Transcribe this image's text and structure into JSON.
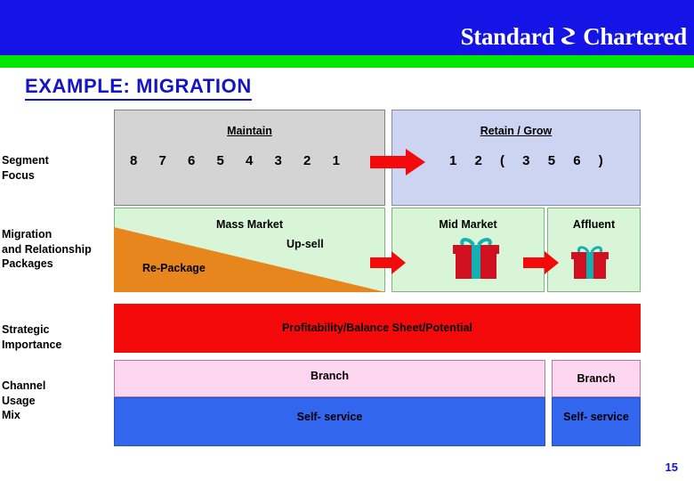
{
  "header": {
    "brand_part1": "Standard",
    "brand_part2": "Chartered",
    "brand_mark_icon": "standard-chartered-logo-icon"
  },
  "title": "EXAMPLE: MIGRATION",
  "row_labels": {
    "segment_focus": "Segment\nFocus",
    "segment_focus_line1": "Segment",
    "segment_focus_line2": "Focus",
    "migration_line1": "Migration",
    "migration_line2": "and Relationship",
    "migration_line3": "Packages",
    "strategic_line1": "Strategic",
    "strategic_line2": "Importance",
    "channel_line1": "Channel",
    "channel_line2": "Usage",
    "channel_line3": "Mix"
  },
  "segment_row": {
    "maintain_header": "Maintain",
    "retain_header": "Retain / Grow",
    "numbers_left": "8 7 6 5 4 3 2 1",
    "numbers_right": "1 2 ( 3 5 6 )"
  },
  "migration_row": {
    "mass_market": "Mass Market",
    "mid_market": "Mid Market",
    "affluent": "Affluent",
    "repackage": "Re-Package",
    "upsell": "Up-sell"
  },
  "strategic_row": {
    "text": "Profitability/Balance Sheet/Potential"
  },
  "channel_row": {
    "branch_left": "Branch",
    "self_service_left": "Self- service",
    "branch_right": "Branch",
    "self_service_right": "Self- service"
  },
  "page_number": "15",
  "colors": {
    "header_blue": "#1414e6",
    "green_band": "#00e800",
    "title_blue": "#1414c8",
    "maintain_gray": "#d4d4d4",
    "retain_lavender": "#ccd4f2",
    "segment_green": "#d8f5d8",
    "repackage_orange": "#e8861e",
    "strategic_red": "#f40a0a",
    "branch_pink": "#ffd6ef",
    "self_service_blue": "#3366ee",
    "arrow_red": "#f40a0a"
  }
}
